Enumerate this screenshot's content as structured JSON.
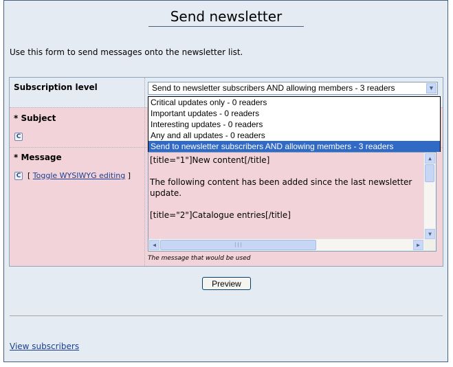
{
  "page": {
    "title": "Send newsletter",
    "intro": "Use this form to send messages onto the newsletter list."
  },
  "form": {
    "subscription_level": {
      "label": "Subscription level",
      "selected": "Send to newsletter subscribers AND allowing members - 3 readers",
      "options": [
        "Critical updates only - 0 readers",
        "Important updates - 0 readers",
        "Interesting updates - 0 readers",
        "Any and all updates - 0 readers",
        "Send to newsletter subscribers AND allowing members - 3 readers"
      ]
    },
    "subject": {
      "required_mark": "*",
      "label": "Subject"
    },
    "message": {
      "required_mark": "*",
      "label": "Message",
      "toggle_open": "[",
      "toggle_label": "Toggle WYSIWYG editing",
      "toggle_close": "]",
      "content": "[title=\"1\"]New content[/title]\n\nThe following content has been added since the last newsletter update.\n\n[title=\"2\"]Catalogue entries[/title]",
      "hint": "The message that would be used"
    },
    "preview_button": "Preview"
  },
  "footer": {
    "view_subscribers": "View subscribers"
  },
  "colors": {
    "frame_bg": "#e4ebf3",
    "field_bg": "#f2d3da",
    "selection": "#316ac5",
    "link": "#1a3f8f"
  },
  "icons": {
    "editor_icon": "comcode-edit-icon",
    "dropdown_arrow": "chevron-down-icon"
  }
}
